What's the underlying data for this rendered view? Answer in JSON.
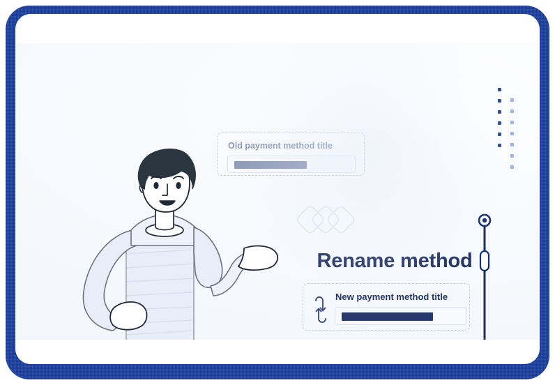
{
  "window": {
    "frame_color": "#1b3fa0",
    "card_color": "#ffffff",
    "canvas_color": "#f3f7fc"
  },
  "headline": {
    "text": "Rename method",
    "color": "#253566"
  },
  "old_field": {
    "label": "Old payment method title",
    "value": "",
    "placeholder": "Old payment method title",
    "label_color": "#8c97b4",
    "fill_color": "#8e99b8",
    "state": "previous"
  },
  "new_field": {
    "label": "New payment method title",
    "value": "",
    "placeholder": "New payment method title",
    "label_color": "#253566",
    "fill_color": "#27386c",
    "icon": "swap-vertical-icon",
    "state": "current"
  },
  "decorations": {
    "diamonds": {
      "name": "chevron-diamonds",
      "count": 3,
      "stroke": "#dfe4f2"
    },
    "dots": {
      "name": "dot-grid",
      "dark_color": "#2c4a9a",
      "light_color": "#9ab3e8",
      "dark_count": 6,
      "light_count": 7
    }
  },
  "slider": {
    "name": "vertical-progress-slider",
    "track_color": "#16306e",
    "handle_shape": "capsule",
    "handle_fill": "#ffffff",
    "top_marker": "circle-dot",
    "handle_position_pct": 28
  },
  "illustration": {
    "name": "person-presenting-illustration",
    "hair_color": "#2b353f",
    "skin_color": "#ffffff",
    "shirt_color": "#e6ebf7",
    "outline_color": "#6b7280",
    "pedestal": true,
    "pose": "one-hand-on-hip-one-hand-open"
  }
}
